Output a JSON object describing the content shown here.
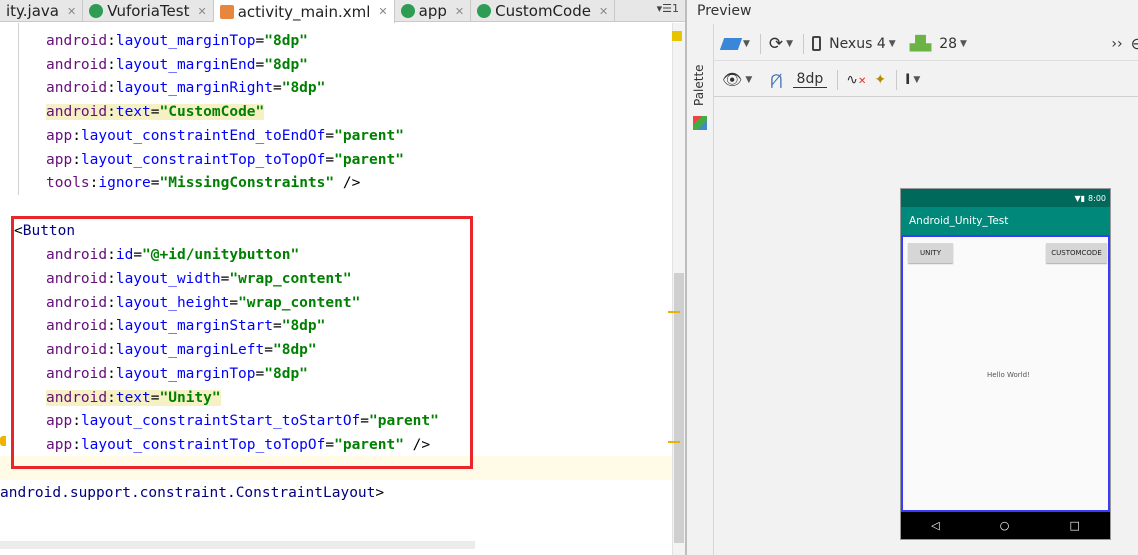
{
  "tabs": [
    {
      "label": "ity.java",
      "icon": "java-file-icon",
      "color": "#e76f00"
    },
    {
      "label": "VuforiaTest",
      "icon": "class-icon",
      "color": "#2e9c53"
    },
    {
      "label": "activity_main.xml",
      "icon": "xml-file-icon",
      "color": "#e9863d",
      "active": true
    },
    {
      "label": "app",
      "icon": "module-icon",
      "color": "#2e9c53"
    },
    {
      "label": "CustomCode",
      "icon": "class-icon",
      "color": "#2e9c53"
    }
  ],
  "tab_overflow": "▾☰1",
  "code_lines": [
    {
      "parts": [
        [
          "ns",
          "android"
        ],
        [
          "pl",
          ":"
        ],
        [
          "at",
          "layout_marginTop"
        ],
        [
          "pl",
          "="
        ],
        [
          "val",
          "\"8dp\""
        ]
      ]
    },
    {
      "parts": [
        [
          "ns",
          "android"
        ],
        [
          "pl",
          ":"
        ],
        [
          "at",
          "layout_marginEnd"
        ],
        [
          "pl",
          "="
        ],
        [
          "val",
          "\"8dp\""
        ]
      ]
    },
    {
      "parts": [
        [
          "ns",
          "android"
        ],
        [
          "pl",
          ":"
        ],
        [
          "at",
          "layout_marginRight"
        ],
        [
          "pl",
          "="
        ],
        [
          "val",
          "\"8dp\""
        ]
      ]
    },
    {
      "parts": [
        [
          "ns",
          "android"
        ],
        [
          "pl",
          ":"
        ],
        [
          "at",
          "text"
        ],
        [
          "pl",
          "="
        ],
        [
          "val",
          "\"CustomCode\""
        ]
      ],
      "highlight": true
    },
    {
      "parts": [
        [
          "ns",
          "app"
        ],
        [
          "pl",
          ":"
        ],
        [
          "at",
          "layout_constraintEnd_toEndOf"
        ],
        [
          "pl",
          "="
        ],
        [
          "val",
          "\"parent\""
        ]
      ]
    },
    {
      "parts": [
        [
          "ns",
          "app"
        ],
        [
          "pl",
          ":"
        ],
        [
          "at",
          "layout_constraintTop_toTopOf"
        ],
        [
          "pl",
          "="
        ],
        [
          "val",
          "\"parent\""
        ]
      ]
    },
    {
      "parts": [
        [
          "ns",
          "tools"
        ],
        [
          "pl",
          ":"
        ],
        [
          "at",
          "ignore"
        ],
        [
          "pl",
          "="
        ],
        [
          "val",
          "\"MissingConstraints\""
        ],
        [
          "pl",
          " />"
        ]
      ]
    },
    {
      "parts": []
    },
    {
      "parts": [
        [
          "pl",
          "<"
        ],
        [
          "tag",
          "Button"
        ]
      ],
      "indent": "outer"
    },
    {
      "parts": [
        [
          "ns",
          "android"
        ],
        [
          "pl",
          ":"
        ],
        [
          "at",
          "id"
        ],
        [
          "pl",
          "="
        ],
        [
          "val",
          "\"@+id/unitybutton\""
        ]
      ]
    },
    {
      "parts": [
        [
          "ns",
          "android"
        ],
        [
          "pl",
          ":"
        ],
        [
          "at",
          "layout_width"
        ],
        [
          "pl",
          "="
        ],
        [
          "val",
          "\"wrap_content\""
        ]
      ]
    },
    {
      "parts": [
        [
          "ns",
          "android"
        ],
        [
          "pl",
          ":"
        ],
        [
          "at",
          "layout_height"
        ],
        [
          "pl",
          "="
        ],
        [
          "val",
          "\"wrap_content\""
        ]
      ]
    },
    {
      "parts": [
        [
          "ns",
          "android"
        ],
        [
          "pl",
          ":"
        ],
        [
          "at",
          "layout_marginStart"
        ],
        [
          "pl",
          "="
        ],
        [
          "val",
          "\"8dp\""
        ]
      ]
    },
    {
      "parts": [
        [
          "ns",
          "android"
        ],
        [
          "pl",
          ":"
        ],
        [
          "at",
          "layout_marginLeft"
        ],
        [
          "pl",
          "="
        ],
        [
          "val",
          "\"8dp\""
        ]
      ]
    },
    {
      "parts": [
        [
          "ns",
          "android"
        ],
        [
          "pl",
          ":"
        ],
        [
          "at",
          "layout_marginTop"
        ],
        [
          "pl",
          "="
        ],
        [
          "val",
          "\"8dp\""
        ]
      ]
    },
    {
      "parts": [
        [
          "ns",
          "android"
        ],
        [
          "pl",
          ":"
        ],
        [
          "at",
          "text"
        ],
        [
          "pl",
          "="
        ],
        [
          "val",
          "\"Unity\""
        ]
      ],
      "highlight": true
    },
    {
      "parts": [
        [
          "ns",
          "app"
        ],
        [
          "pl",
          ":"
        ],
        [
          "at",
          "layout_constraintStart_toStartOf"
        ],
        [
          "pl",
          "="
        ],
        [
          "val",
          "\"parent\""
        ]
      ]
    },
    {
      "parts": [
        [
          "ns",
          "app"
        ],
        [
          "pl",
          ":"
        ],
        [
          "at",
          "layout_constraintTop_toTopOf"
        ],
        [
          "pl",
          "="
        ],
        [
          "val",
          "\"parent\""
        ],
        [
          "pl",
          " />"
        ]
      ]
    },
    {
      "parts": []
    },
    {
      "parts": [
        [
          "tag",
          "android.support.constraint.ConstraintLayout"
        ],
        [
          "pl",
          ">"
        ]
      ],
      "indent": "closing"
    }
  ],
  "preview": {
    "title": "Preview",
    "palette_label": "Palette",
    "device": "Nexus 4",
    "api": "28",
    "margin": "8dp",
    "status_time": "8:00",
    "app_title": "Android_Unity_Test",
    "unity_button": "UNITY",
    "custom_button": "CUSTOMCODE",
    "hello_text": "Hello World!",
    "nav_back": "◁",
    "nav_home": "○",
    "nav_recent": "□"
  }
}
